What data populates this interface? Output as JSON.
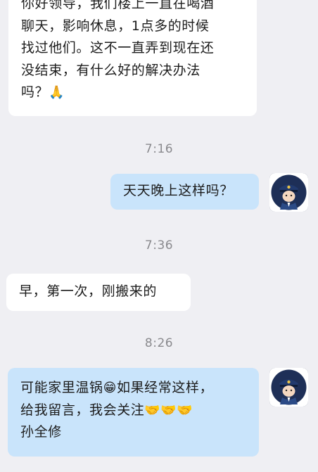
{
  "messages": [
    {
      "side": "incoming",
      "lines": [
        "你好领导，我们楼上一直在喝酒",
        "聊天，影响休息，1点多的时候",
        "找过他们。这不一直弄到现在还",
        "没结束，有什么好的解决办法",
        "吗？"
      ],
      "emoji": "🙏"
    },
    {
      "time": "7:16"
    },
    {
      "side": "outgoing",
      "lines": [
        "天天晚上这样吗？"
      ]
    },
    {
      "time": "7:36"
    },
    {
      "side": "incoming",
      "lines": [
        "早，第一次，刚搬来的"
      ]
    },
    {
      "time": "8:26"
    },
    {
      "side": "outgoing",
      "line1_a": "可能家里温锅",
      "line1_emoji": "😁",
      "line1_b": "如果经常这样，",
      "line2_text": "给我留言，我会关注",
      "line2_emoji": "🤝🤝🤝",
      "line3": "孙全修"
    }
  ],
  "colors": {
    "incoming": "#ffffff",
    "outgoing": "#c9e4fb",
    "background": "#efeff3",
    "time": "#8a8a8e"
  },
  "icons": {
    "avatar": "police-cartoon-avatar-icon"
  }
}
